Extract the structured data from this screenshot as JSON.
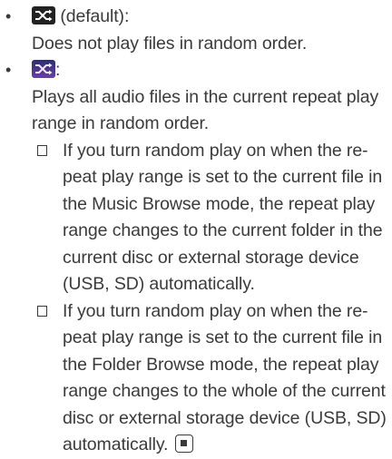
{
  "items": [
    {
      "icon": "random-off-icon",
      "label_suffix": " (default):",
      "description": "Does not play files in random order."
    },
    {
      "icon": "random-on-icon",
      "label_suffix": ":",
      "description": "Plays all audio files in the current repeat play range in random order."
    }
  ],
  "notes": [
    "If you turn random play on when the re-peat play range is set to the current file in the Music Browse mode, the repeat play range changes to the current folder in the current disc or external storage device (USB, SD) automatically.",
    "If you turn random play on when the re-peat play range is set to the current file in the Folder Browse mode, the repeat play range changes to the whole of the current disc or external storage device (USB, SD) automatically."
  ],
  "bullet_char": "•",
  "colors": {
    "text": "#3a3a3a",
    "random_off_icon_bg": "#222222",
    "random_on_icon_bg": "#6a3fa8"
  }
}
